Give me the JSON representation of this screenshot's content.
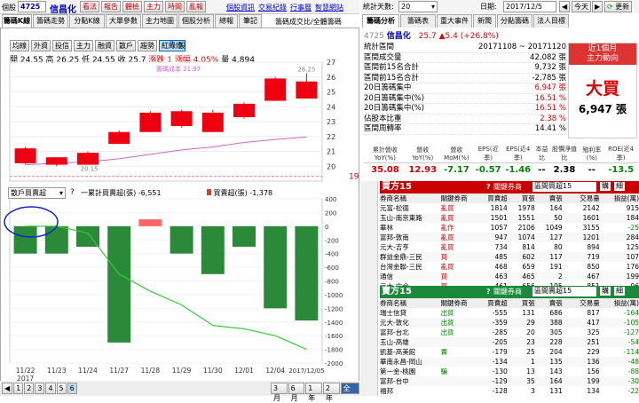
{
  "header": {
    "stock_label": "個股",
    "code": "4725",
    "name": "信昌化",
    "buttons": [
      "看法",
      "報告",
      "體檢",
      "主力",
      "時間",
      "亂報"
    ],
    "links": [
      "個股資訊",
      "交易紀錄",
      "行事曆",
      "智慧網站"
    ]
  },
  "left_tabs": [
    "籌碼K線",
    "籌碼走勢",
    "分點K線",
    "大單參數",
    "主力地圖",
    "個股分析",
    "總報",
    "筆記"
  ],
  "left_note": "籌碼成交比/全體籌碼",
  "chart_toolbar": [
    "均線",
    "外資",
    "投信",
    "主力",
    "融資",
    "散戶",
    "趨勢",
    "紅綠燈"
  ],
  "chart_toolbar_active": "紅綠燈",
  "ohlc": {
    "open_label": "開",
    "open": "24.55",
    "high_label": "高",
    "high": "26.25",
    "low_label": "低",
    "low": "24.55",
    "close_label": "收",
    "close": "25.7",
    "change_label": "漲跌",
    "change": "1",
    "pct_label": "漲幅",
    "pct": "4.05%",
    "vol_label": "量",
    "vol": "4,894"
  },
  "cost_line_label": "籌碼成本 21.97",
  "price_low_marker": "20.15",
  "price_high_marker": "26.25",
  "price_ref": "19.33",
  "sub_selector": "散戶買賣超",
  "sub_legend": {
    "cum_label": "一累計買賣超(張)",
    "cum_value": "-6,551",
    "bar_label": "買賣超(張)",
    "bar_value": "-1,378"
  },
  "dates": [
    "11/22",
    "11/23",
    "11/24",
    "11/27",
    "11/28",
    "11/29",
    "11/30",
    "12/01",
    "12/04",
    "2017/12/05"
  ],
  "year_label": "2017",
  "range_buttons": [
    "3月",
    "6月",
    "1年",
    "2年",
    "全部"
  ],
  "range_active": "全部",
  "page_buttons": [
    "1",
    "2",
    "3",
    "4",
    "5",
    "6"
  ],
  "chart_data": [
    {
      "type": "candlestick",
      "categories": [
        "11/22",
        "11/23",
        "11/24",
        "11/27",
        "11/28",
        "11/29",
        "11/30",
        "12/01",
        "12/04",
        "12/05"
      ],
      "open": [
        20.2,
        20.6,
        20.1,
        21.5,
        22.3,
        22.7,
        22.3,
        23.3,
        24.4,
        24.55
      ],
      "close": [
        21.2,
        20.1,
        20.9,
        22.3,
        23.6,
        23.7,
        23.6,
        24.2,
        25.9,
        25.7
      ],
      "high": [
        21.3,
        20.6,
        21.0,
        22.4,
        23.7,
        23.8,
        23.8,
        24.3,
        26.0,
        26.25
      ],
      "low": [
        20.15,
        20.0,
        20.1,
        21.5,
        22.3,
        22.6,
        22.3,
        23.2,
        24.4,
        24.55
      ],
      "cost_line": [
        20.1,
        20.2,
        20.3,
        20.5,
        20.8,
        21.1,
        21.3,
        21.6,
        21.8,
        21.97
      ],
      "ylim": [
        19.0,
        27.0
      ],
      "ticks": [
        20,
        21,
        22,
        23,
        24,
        25,
        26,
        27
      ]
    },
    {
      "type": "bar",
      "categories": [
        "11/22",
        "11/23",
        "11/24",
        "11/27",
        "11/28",
        "11/29",
        "11/30",
        "12/01",
        "12/04",
        "12/05"
      ],
      "values": [
        -400,
        -400,
        -300,
        -1700,
        100,
        -400,
        -700,
        -300,
        -1200,
        -1378
      ],
      "cumulative": [
        0,
        0,
        -100,
        -700,
        -950,
        -1150,
        -1450,
        -1500,
        -1600,
        -1800
      ],
      "ylim": [
        -2000,
        400
      ],
      "ticks": [
        400,
        200,
        0,
        -200,
        -400,
        -600,
        -800,
        -1000,
        -1200,
        -1400,
        -1600,
        -1800,
        -2000
      ]
    }
  ],
  "right_top": {
    "period_label": "統計天數:",
    "period_value": "20",
    "date_label": "日期:",
    "date_value": "2017/12/5",
    "today_btn": "今天",
    "update_btn": "更新"
  },
  "right_tabs": [
    "籌碼分析",
    "籌碼表",
    "重大事件",
    "新聞",
    "分點籌碼",
    "法人目標"
  ],
  "stock_info": {
    "code": "4725",
    "name": "信昌化",
    "price": "25.7",
    "change": "▲5.4 (+26.8%)"
  },
  "stats": [
    {
      "label": "統計區間",
      "value": "20171108 ~ 20171120",
      "color": "#000"
    },
    {
      "label": "區間成交量",
      "value": "42,082 張",
      "color": "#000"
    },
    {
      "label": "區間前15名合計",
      "value": "9,732 張",
      "color": "#000"
    },
    {
      "label": "區間前15名合計",
      "value": "-2,785 張",
      "color": "#000"
    },
    {
      "label": "20日籌碼集中",
      "value": "6,947 張",
      "color": "#d00"
    },
    {
      "label": "20日籌碼集中(%)",
      "value": "16.51 %",
      "color": "#d00"
    },
    {
      "label": "20日籌碼集中(%)",
      "value": "16.51 %",
      "color": "#d00"
    },
    {
      "label": "佔股本比重",
      "value": "2.38 %",
      "color": "#d00"
    },
    {
      "label": "區間周轉率",
      "value": "14.41 %",
      "color": "#000"
    }
  ],
  "big_buy": {
    "period": "近1個月",
    "sub": "主力動向",
    "label": "大買",
    "value": "6,947 張"
  },
  "fin": {
    "headers": [
      "累計營收YoY(%)",
      "營收YoY(%)",
      "營收MoM(%)",
      "EPS(近季)",
      "EPS(近4季)",
      "本益比",
      "股價淨值比",
      "殖利率(%)",
      "ROE(近4季)"
    ],
    "values": [
      "35.08",
      "12.93",
      "-7.17",
      "-0.57",
      "-1.46",
      "--",
      "2.38",
      "--",
      "-13.5"
    ],
    "colors": [
      "#d00",
      "#d00",
      "#080",
      "#080",
      "#080",
      "#000",
      "#000",
      "#000",
      "#080"
    ]
  },
  "buy_table": {
    "title": "買方15",
    "subtitle": "關鍵券商",
    "dropdown": "區間買超15",
    "btn1": "購",
    "btn2": "細",
    "headers": [
      "券商名稱",
      "關鍵券商",
      "買賣超",
      "買張",
      "賣張",
      "交易量",
      "損益(萬)"
    ],
    "rows": [
      [
        "元富-松德",
        "亂買",
        "1814",
        "1978",
        "164",
        "2142",
        "915"
      ],
      [
        "玉山-南京東路",
        "亂買",
        "1501",
        "1551",
        "50",
        "1601",
        "184"
      ],
      [
        "華林",
        "亂作",
        "1057",
        "2106",
        "1049",
        "3155",
        "-25"
      ],
      [
        "富邦-敦南",
        "亂買",
        "947",
        "1074",
        "127",
        "1201",
        "284"
      ],
      [
        "元大-吉亨",
        "亂買",
        "734",
        "814",
        "80",
        "894",
        "125"
      ],
      [
        "群益金鼎-三民",
        "買",
        "485",
        "602",
        "117",
        "719",
        "107"
      ],
      [
        "台灣金聯-三民",
        "亂買",
        "468",
        "659",
        "191",
        "850",
        "176"
      ],
      [
        "通信",
        "買",
        "463",
        "465",
        "2",
        "467",
        "199"
      ],
      [
        "元大-六合",
        "買",
        "461",
        "656",
        "195",
        "851",
        "96"
      ]
    ]
  },
  "sell_table": {
    "title": "賣方15",
    "subtitle": "關鍵券商",
    "dropdown": "區間賣超15",
    "btn1": "購",
    "btn2": "細",
    "headers": [
      "券商名稱",
      "關鍵券商",
      "買賣超",
      "買張",
      "賣張",
      "交易量",
      "損益(萬)"
    ],
    "rows": [
      [
        "瑞士信貸",
        "出貨",
        "-555",
        "131",
        "686",
        "817",
        "-164"
      ],
      [
        "元大-敦化",
        "出貨",
        "-359",
        "29",
        "388",
        "417",
        "-105"
      ],
      [
        "富邦-台北",
        "出貨",
        "-285",
        "20",
        "305",
        "325",
        "-127"
      ],
      [
        "玉山-高雄",
        "",
        "-205",
        "23",
        "228",
        "251",
        "-54"
      ],
      [
        "凱基-高美館",
        "賣",
        "-179",
        "25",
        "204",
        "229",
        "-114"
      ],
      [
        "華南永昌-岡山",
        "",
        "-134",
        "1",
        "135",
        "136",
        "-48"
      ],
      [
        "第一金-桃園",
        "騙",
        "-130",
        "13",
        "143",
        "156",
        "-88"
      ],
      [
        "富邦-台中",
        "",
        "-129",
        "35",
        "164",
        "199",
        "-30"
      ],
      [
        "福邦",
        "",
        "-128",
        "3",
        "131",
        "134",
        "-22"
      ]
    ]
  }
}
